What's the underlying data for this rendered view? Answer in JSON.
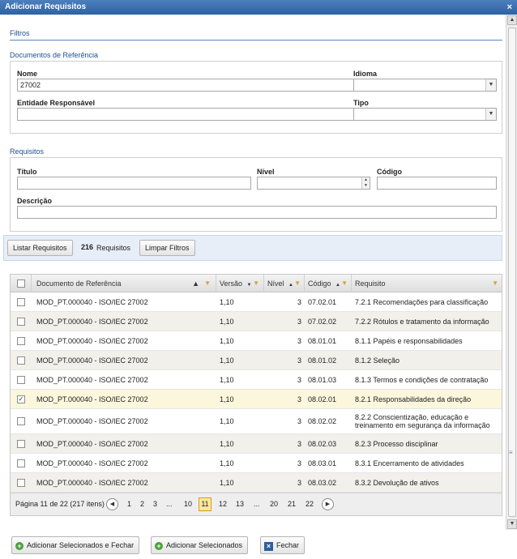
{
  "window": {
    "title": "Adicionar Requisitos",
    "close": "×"
  },
  "filters": {
    "heading": "Filtros"
  },
  "docs": {
    "heading": "Documentos de Referência",
    "nome_label": "Nome",
    "nome_value": "27002",
    "idioma_label": "Idioma",
    "idioma_value": "",
    "entidade_label": "Entidade Responsável",
    "entidade_value": "",
    "tipo_label": "Tipo",
    "tipo_value": ""
  },
  "reqs": {
    "heading": "Requisitos",
    "titulo_label": "Título",
    "titulo_value": "",
    "nivel_label": "Nível",
    "nivel_value": "",
    "codigo_label": "Código",
    "codigo_value": "",
    "descricao_label": "Descrição",
    "descricao_value": ""
  },
  "toolbar": {
    "list_label": "Listar Requisitos",
    "count": "216",
    "count_label": "Requisitos",
    "clear_label": "Limpar Filtros"
  },
  "grid": {
    "headers": {
      "doc": "Documento de Referência",
      "versao": "Versão",
      "nivel": "Nível",
      "codigo": "Código",
      "requisito": "Requisito"
    },
    "rows": [
      {
        "doc": "MOD_PT.000040 - ISO/IEC 27002",
        "versao": "1,10",
        "nivel": "3",
        "codigo": "07.02.01",
        "requisito": "7.2.1 Recomendações para classificação",
        "checked": ""
      },
      {
        "doc": "MOD_PT.000040 - ISO/IEC 27002",
        "versao": "1,10",
        "nivel": "3",
        "codigo": "07.02.02",
        "requisito": "7.2.2 Rótulos e tratamento da informação",
        "checked": ""
      },
      {
        "doc": "MOD_PT.000040 - ISO/IEC 27002",
        "versao": "1,10",
        "nivel": "3",
        "codigo": "08.01.01",
        "requisito": "8.1.1 Papéis e responsabilidades",
        "checked": ""
      },
      {
        "doc": "MOD_PT.000040 - ISO/IEC 27002",
        "versao": "1,10",
        "nivel": "3",
        "codigo": "08.01.02",
        "requisito": "8.1.2 Seleção",
        "checked": ""
      },
      {
        "doc": "MOD_PT.000040 - ISO/IEC 27002",
        "versao": "1,10",
        "nivel": "3",
        "codigo": "08.01.03",
        "requisito": "8.1.3 Termos e condições de contratação",
        "checked": ""
      },
      {
        "doc": "MOD_PT.000040 - ISO/IEC 27002",
        "versao": "1,10",
        "nivel": "3",
        "codigo": "08.02.01",
        "requisito": "8.2.1 Responsabilidades da direção",
        "checked": "✓"
      },
      {
        "doc": "MOD_PT.000040 - ISO/IEC 27002",
        "versao": "1,10",
        "nivel": "3",
        "codigo": "08.02.02",
        "requisito": "8.2.2 Conscientização, educação e treinamento em segurança da informação",
        "checked": ""
      },
      {
        "doc": "MOD_PT.000040 - ISO/IEC 27002",
        "versao": "1,10",
        "nivel": "3",
        "codigo": "08.02.03",
        "requisito": "8.2.3 Processo disciplinar",
        "checked": ""
      },
      {
        "doc": "MOD_PT.000040 - ISO/IEC 27002",
        "versao": "1,10",
        "nivel": "3",
        "codigo": "08.03.01",
        "requisito": "8.3.1 Encerramento de atividades",
        "checked": ""
      },
      {
        "doc": "MOD_PT.000040 - ISO/IEC 27002",
        "versao": "1,10",
        "nivel": "3",
        "codigo": "08.03.02",
        "requisito": "8.3.2 Devolução de ativos",
        "checked": ""
      }
    ]
  },
  "pager": {
    "info": "Página 11 de 22 (217 itens)",
    "pages_before": [
      "1",
      "2",
      "3",
      "...",
      "10"
    ],
    "current": "11",
    "pages_after": [
      "12",
      "13",
      "...",
      "20",
      "21",
      "22"
    ]
  },
  "footer": {
    "add_close_label": "Adicionar Selecionados e Fechar",
    "add_label": "Adicionar Selecionados",
    "close_label": "Fechar"
  }
}
